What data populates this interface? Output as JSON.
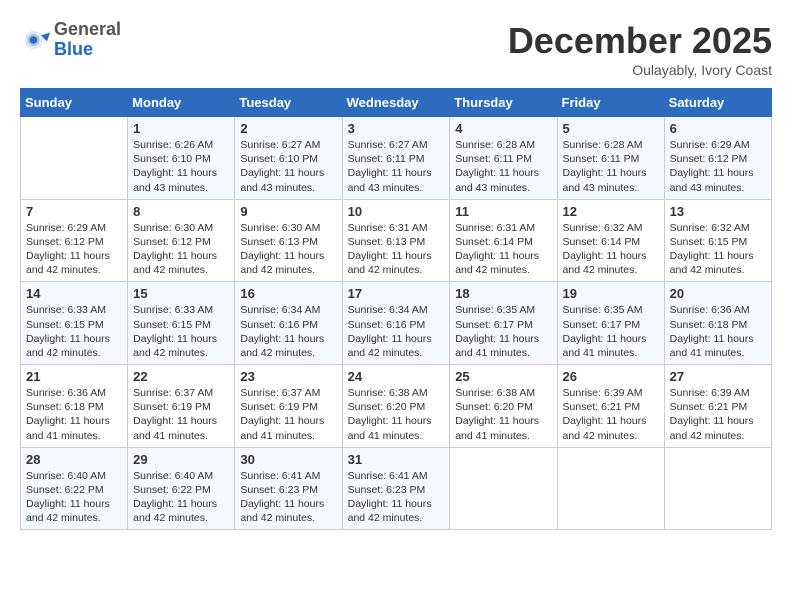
{
  "header": {
    "logo": {
      "general": "General",
      "blue": "Blue"
    },
    "title": "December 2025",
    "location": "Oulayably, Ivory Coast"
  },
  "weekdays": [
    "Sunday",
    "Monday",
    "Tuesday",
    "Wednesday",
    "Thursday",
    "Friday",
    "Saturday"
  ],
  "weeks": [
    [
      {
        "day": "",
        "detail": ""
      },
      {
        "day": "1",
        "detail": "Sunrise: 6:26 AM\nSunset: 6:10 PM\nDaylight: 11 hours\nand 43 minutes."
      },
      {
        "day": "2",
        "detail": "Sunrise: 6:27 AM\nSunset: 6:10 PM\nDaylight: 11 hours\nand 43 minutes."
      },
      {
        "day": "3",
        "detail": "Sunrise: 6:27 AM\nSunset: 6:11 PM\nDaylight: 11 hours\nand 43 minutes."
      },
      {
        "day": "4",
        "detail": "Sunrise: 6:28 AM\nSunset: 6:11 PM\nDaylight: 11 hours\nand 43 minutes."
      },
      {
        "day": "5",
        "detail": "Sunrise: 6:28 AM\nSunset: 6:11 PM\nDaylight: 11 hours\nand 43 minutes."
      },
      {
        "day": "6",
        "detail": "Sunrise: 6:29 AM\nSunset: 6:12 PM\nDaylight: 11 hours\nand 43 minutes."
      }
    ],
    [
      {
        "day": "7",
        "detail": "Sunrise: 6:29 AM\nSunset: 6:12 PM\nDaylight: 11 hours\nand 42 minutes."
      },
      {
        "day": "8",
        "detail": "Sunrise: 6:30 AM\nSunset: 6:12 PM\nDaylight: 11 hours\nand 42 minutes."
      },
      {
        "day": "9",
        "detail": "Sunrise: 6:30 AM\nSunset: 6:13 PM\nDaylight: 11 hours\nand 42 minutes."
      },
      {
        "day": "10",
        "detail": "Sunrise: 6:31 AM\nSunset: 6:13 PM\nDaylight: 11 hours\nand 42 minutes."
      },
      {
        "day": "11",
        "detail": "Sunrise: 6:31 AM\nSunset: 6:14 PM\nDaylight: 11 hours\nand 42 minutes."
      },
      {
        "day": "12",
        "detail": "Sunrise: 6:32 AM\nSunset: 6:14 PM\nDaylight: 11 hours\nand 42 minutes."
      },
      {
        "day": "13",
        "detail": "Sunrise: 6:32 AM\nSunset: 6:15 PM\nDaylight: 11 hours\nand 42 minutes."
      }
    ],
    [
      {
        "day": "14",
        "detail": "Sunrise: 6:33 AM\nSunset: 6:15 PM\nDaylight: 11 hours\nand 42 minutes."
      },
      {
        "day": "15",
        "detail": "Sunrise: 6:33 AM\nSunset: 6:15 PM\nDaylight: 11 hours\nand 42 minutes."
      },
      {
        "day": "16",
        "detail": "Sunrise: 6:34 AM\nSunset: 6:16 PM\nDaylight: 11 hours\nand 42 minutes."
      },
      {
        "day": "17",
        "detail": "Sunrise: 6:34 AM\nSunset: 6:16 PM\nDaylight: 11 hours\nand 42 minutes."
      },
      {
        "day": "18",
        "detail": "Sunrise: 6:35 AM\nSunset: 6:17 PM\nDaylight: 11 hours\nand 41 minutes."
      },
      {
        "day": "19",
        "detail": "Sunrise: 6:35 AM\nSunset: 6:17 PM\nDaylight: 11 hours\nand 41 minutes."
      },
      {
        "day": "20",
        "detail": "Sunrise: 6:36 AM\nSunset: 6:18 PM\nDaylight: 11 hours\nand 41 minutes."
      }
    ],
    [
      {
        "day": "21",
        "detail": "Sunrise: 6:36 AM\nSunset: 6:18 PM\nDaylight: 11 hours\nand 41 minutes."
      },
      {
        "day": "22",
        "detail": "Sunrise: 6:37 AM\nSunset: 6:19 PM\nDaylight: 11 hours\nand 41 minutes."
      },
      {
        "day": "23",
        "detail": "Sunrise: 6:37 AM\nSunset: 6:19 PM\nDaylight: 11 hours\nand 41 minutes."
      },
      {
        "day": "24",
        "detail": "Sunrise: 6:38 AM\nSunset: 6:20 PM\nDaylight: 11 hours\nand 41 minutes."
      },
      {
        "day": "25",
        "detail": "Sunrise: 6:38 AM\nSunset: 6:20 PM\nDaylight: 11 hours\nand 41 minutes."
      },
      {
        "day": "26",
        "detail": "Sunrise: 6:39 AM\nSunset: 6:21 PM\nDaylight: 11 hours\nand 42 minutes."
      },
      {
        "day": "27",
        "detail": "Sunrise: 6:39 AM\nSunset: 6:21 PM\nDaylight: 11 hours\nand 42 minutes."
      }
    ],
    [
      {
        "day": "28",
        "detail": "Sunrise: 6:40 AM\nSunset: 6:22 PM\nDaylight: 11 hours\nand 42 minutes."
      },
      {
        "day": "29",
        "detail": "Sunrise: 6:40 AM\nSunset: 6:22 PM\nDaylight: 11 hours\nand 42 minutes."
      },
      {
        "day": "30",
        "detail": "Sunrise: 6:41 AM\nSunset: 6:23 PM\nDaylight: 11 hours\nand 42 minutes."
      },
      {
        "day": "31",
        "detail": "Sunrise: 6:41 AM\nSunset: 6:23 PM\nDaylight: 11 hours\nand 42 minutes."
      },
      {
        "day": "",
        "detail": ""
      },
      {
        "day": "",
        "detail": ""
      },
      {
        "day": "",
        "detail": ""
      }
    ]
  ]
}
